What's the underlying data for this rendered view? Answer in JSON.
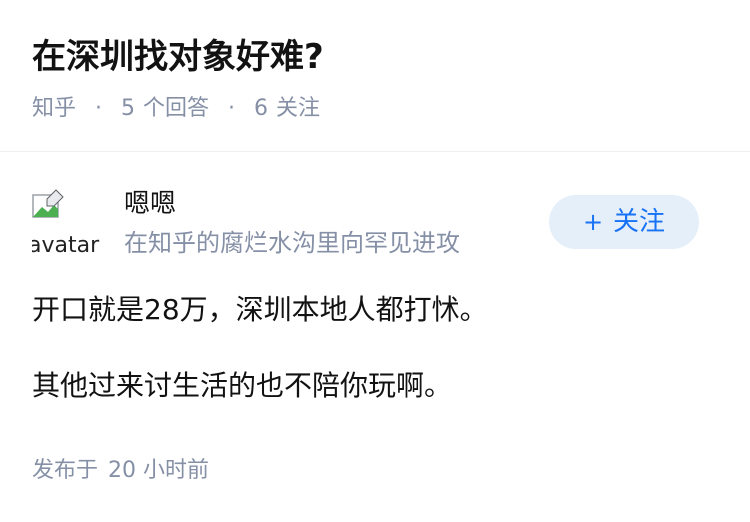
{
  "question": {
    "title": "在深圳找对象好难?",
    "source": "知乎",
    "separator": "·",
    "answers_count": "5",
    "answers_label": "个回答",
    "followers_count": "6",
    "followers_label": "关注"
  },
  "answer": {
    "author": {
      "avatar_alt": "avatar",
      "name": "嗯嗯",
      "headline": "在知乎的腐烂水沟里向罕见进攻"
    },
    "follow_button": {
      "icon": "+",
      "label": "关注"
    },
    "paragraphs": [
      "开口就是28万，深圳本地人都打怵。",
      "其他过来讨生活的也不陪你玩啊。"
    ],
    "published": {
      "label": "发布于",
      "time": "20 小时前"
    }
  },
  "colors": {
    "text_primary": "#121212",
    "text_secondary": "#8590a6",
    "accent": "#1772f6",
    "follow_bg": "#e5effa",
    "divider": "#eef0f3"
  }
}
